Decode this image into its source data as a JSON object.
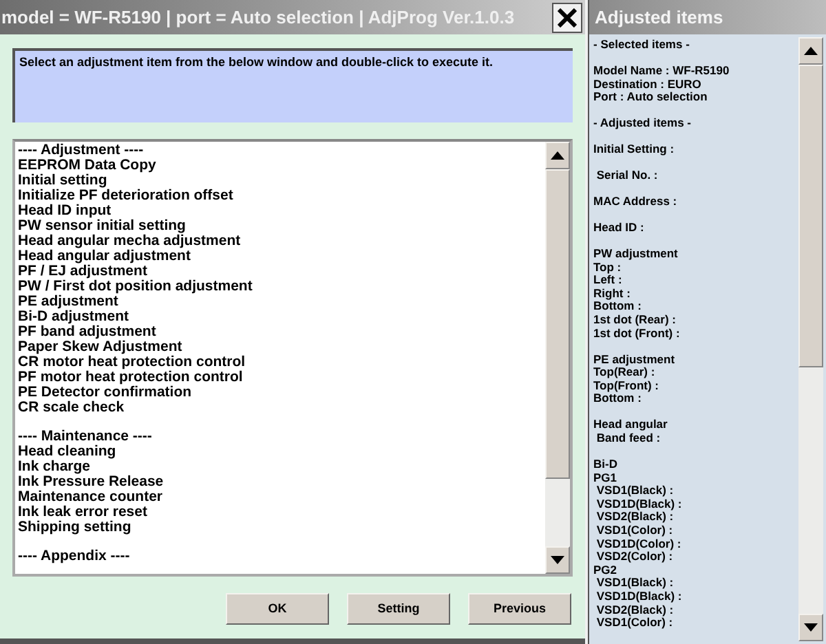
{
  "window": {
    "title": "model = WF-R5190 | port = Auto selection | AdjProg Ver.1.0.3"
  },
  "instruction": "Select an adjustment item from the below window and double-click to execute it.",
  "list": {
    "sections": [
      [
        "---- Adjustment ----",
        "EEPROM Data Copy",
        "Initial setting",
        "Initialize PF deterioration offset",
        "Head ID input",
        "PW sensor initial setting",
        "Head angular mecha adjustment",
        "Head angular adjustment",
        "PF / EJ adjustment",
        "PW / First dot position adjustment",
        "PE adjustment",
        "Bi-D adjustment",
        "PF band adjustment",
        "Paper Skew Adjustment",
        "CR motor heat protection control",
        "PF motor heat protection control",
        "PE Detector confirmation",
        "CR scale check"
      ],
      [
        "---- Maintenance ----",
        "Head cleaning",
        "Ink charge",
        "Ink Pressure Release",
        "Maintenance counter",
        "Ink leak error reset",
        "Shipping setting"
      ],
      [
        "---- Appendix ----"
      ]
    ]
  },
  "buttons": [
    "OK",
    "Setting",
    "Previous"
  ],
  "side_panel": {
    "title": "Adjusted items",
    "sections": [
      [
        "- Selected items -"
      ],
      [
        "Model Name : WF-R5190",
        "Destination : EURO",
        "Port : Auto selection"
      ],
      [
        "- Adjusted items -"
      ],
      [
        "Initial Setting :"
      ],
      [
        " Serial No. :"
      ],
      [
        "MAC Address :"
      ],
      [
        "Head ID :"
      ],
      [
        "PW adjustment",
        "Top :",
        "Left :",
        "Right :",
        "Bottom :",
        "1st dot (Rear) :",
        "1st dot (Front) :"
      ],
      [
        "PE adjustment",
        "Top(Rear) :",
        "Top(Front) :",
        "Bottom :"
      ],
      [
        "Head angular",
        " Band feed :"
      ],
      [
        "Bi-D",
        "PG1",
        " VSD1(Black) :",
        " VSD1D(Black) :",
        " VSD2(Black) :",
        " VSD1(Color) :",
        " VSD1D(Color) :",
        " VSD2(Color) :",
        "PG2",
        " VSD1(Black) :",
        " VSD1D(Black) :",
        " VSD2(Black) :",
        " VSD1(Color) :"
      ]
    ]
  }
}
